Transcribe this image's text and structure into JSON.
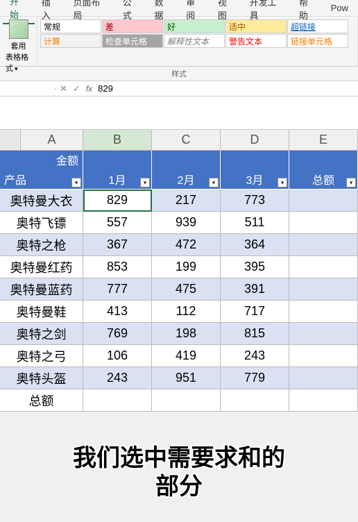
{
  "tabs": [
    "开始",
    "插入",
    "页面布局",
    "公式",
    "数据",
    "审阅",
    "视图",
    "开发工具",
    "帮助",
    "Pow"
  ],
  "activeTab": 0,
  "formatBtn": {
    "line1": "套用",
    "line2": "表格格式"
  },
  "styles": {
    "row1": [
      "常规",
      "差",
      "好",
      "适中",
      "超链接"
    ],
    "row2": [
      "计算",
      "检查单元格",
      "解释性文本",
      "警告文本",
      "链接单元格"
    ]
  },
  "stylesGroupLabel": "样式",
  "formulaBar": {
    "nameBox": "",
    "fx": "fx",
    "value": "829"
  },
  "columns": [
    "A",
    "B",
    "C",
    "D",
    "E"
  ],
  "selectedCol": 1,
  "tableHeader": {
    "topLeft": "金额",
    "bottomLeft": "产品",
    "months": [
      "1月",
      "2月",
      "3月"
    ],
    "total": "总额"
  },
  "rows": [
    {
      "prod": "奥特曼大衣",
      "v": [
        "829",
        "217",
        "773"
      ],
      "band": true
    },
    {
      "prod": "奥特飞镖",
      "v": [
        "557",
        "939",
        "511"
      ],
      "band": false
    },
    {
      "prod": "奥特之枪",
      "v": [
        "367",
        "472",
        "364"
      ],
      "band": true
    },
    {
      "prod": "奥特曼红药",
      "v": [
        "853",
        "199",
        "395"
      ],
      "band": false
    },
    {
      "prod": "奥特曼蓝药",
      "v": [
        "777",
        "475",
        "391"
      ],
      "band": true
    },
    {
      "prod": "奥特曼鞋",
      "v": [
        "413",
        "112",
        "717"
      ],
      "band": false
    },
    {
      "prod": "奥特之剑",
      "v": [
        "769",
        "198",
        "815"
      ],
      "band": true
    },
    {
      "prod": "奥特之弓",
      "v": [
        "106",
        "419",
        "243"
      ],
      "band": false
    },
    {
      "prod": "奥特头盔",
      "v": [
        "243",
        "951",
        "779"
      ],
      "band": true
    }
  ],
  "totalRowLabel": "总额",
  "selectedCell": {
    "row": 0,
    "col": 0
  },
  "caption": {
    "line1": "我们选中需要求和的",
    "line2": "部分"
  }
}
